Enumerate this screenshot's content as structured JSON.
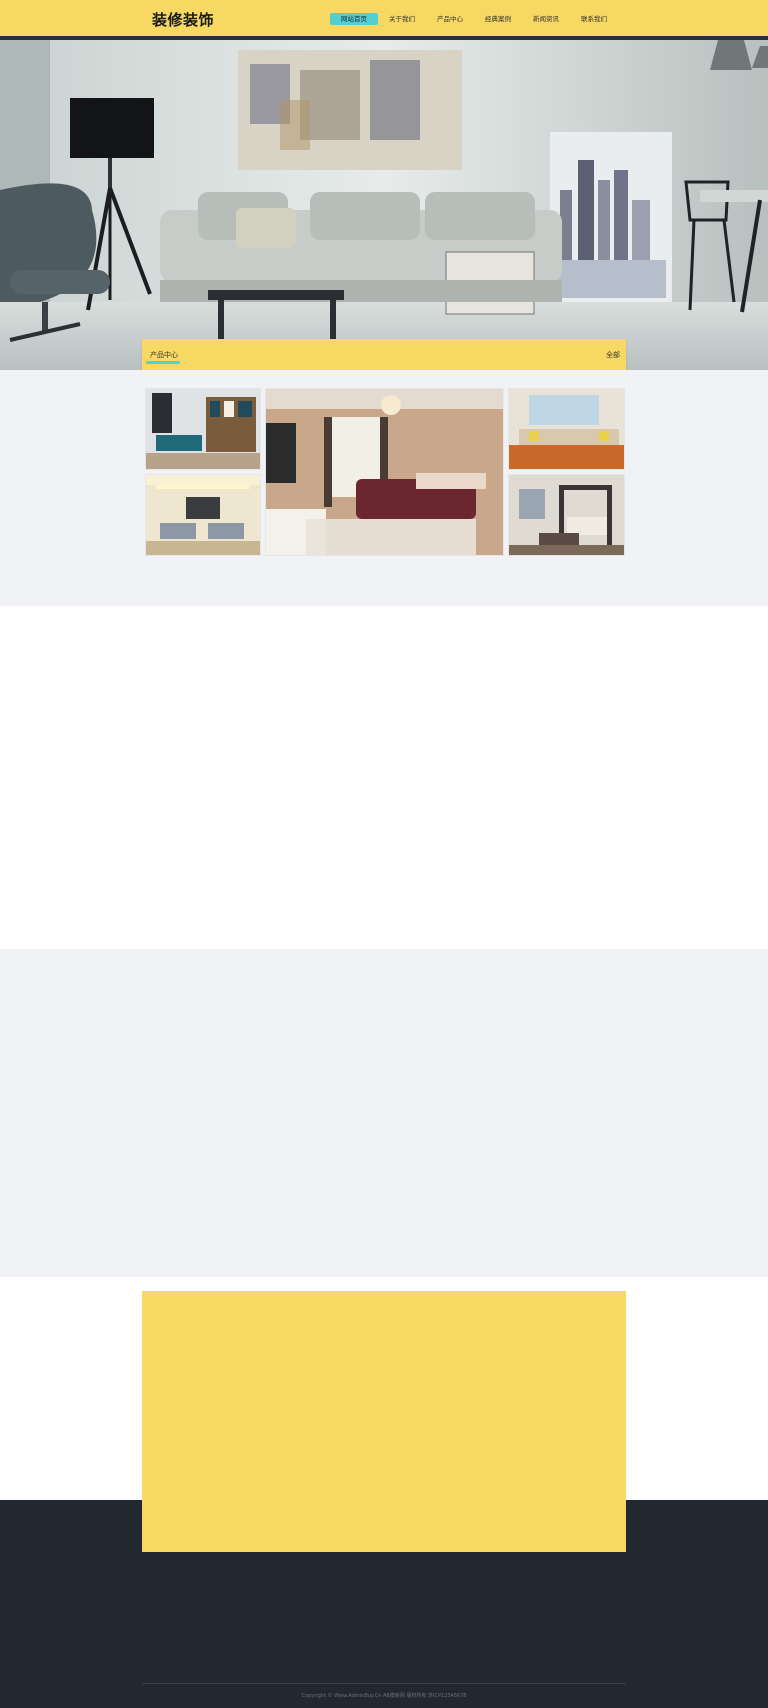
{
  "header": {
    "logo": "装修装饰",
    "nav": [
      {
        "label": "网站首页",
        "active": true
      },
      {
        "label": "关于我们",
        "active": false
      },
      {
        "label": "产品中心",
        "active": false
      },
      {
        "label": "经典案例",
        "active": false
      },
      {
        "label": "新闻资讯",
        "active": false
      },
      {
        "label": "联系我们",
        "active": false
      }
    ]
  },
  "products": {
    "title": "产品中心",
    "more": "全部"
  },
  "footer": {
    "copyright": "Copyright © Www.AdminBuy.Cn AB模板网 版权所有   苏ICP12345678"
  },
  "colors": {
    "brand_yellow": "#f7d862",
    "accent_cyan": "#52cfd1",
    "footer_dark": "#222831"
  }
}
